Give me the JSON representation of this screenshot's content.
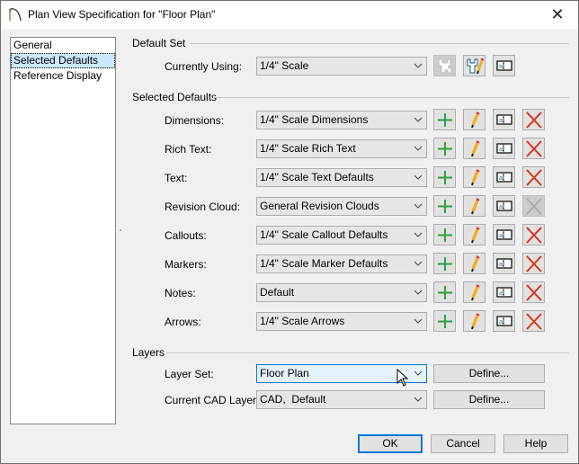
{
  "window": {
    "title": "Plan View Specification for \"Floor Plan\"",
    "close_icon": "close-icon"
  },
  "sidebar": {
    "items": [
      {
        "label": "General",
        "selected": false
      },
      {
        "label": "Selected Defaults",
        "selected": true
      },
      {
        "label": "Reference Display",
        "selected": false
      }
    ]
  },
  "default_set": {
    "group_label": "Default Set",
    "currently_using_label": "Currently Using:",
    "currently_using_value": "1/4\" Scale",
    "icons": [
      "save-default-set-icon",
      "edit-default-set-icon",
      "text-style-icon"
    ]
  },
  "selected_defaults": {
    "group_label": "Selected Defaults",
    "rows": [
      {
        "label": "Dimensions:",
        "value": "1/4\" Scale Dimensions",
        "delete_enabled": true
      },
      {
        "label": "Rich Text:",
        "value": "1/4\" Scale Rich Text",
        "delete_enabled": true
      },
      {
        "label": "Text:",
        "value": "1/4\" Scale Text Defaults",
        "delete_enabled": true
      },
      {
        "label": "Revision Cloud:",
        "value": "General Revision Clouds",
        "delete_enabled": false
      },
      {
        "label": "Callouts:",
        "value": "1/4\" Scale Callout Defaults",
        "delete_enabled": true
      },
      {
        "label": "Markers:",
        "value": "1/4\" Scale Marker Defaults",
        "delete_enabled": true
      },
      {
        "label": "Notes:",
        "value": "Default",
        "delete_enabled": true
      },
      {
        "label": "Arrows:",
        "value": "1/4\" Scale Arrows",
        "delete_enabled": true
      }
    ]
  },
  "layers": {
    "group_label": "Layers",
    "layer_set_label": "Layer Set:",
    "layer_set_value": "Floor Plan",
    "cad_layer_label": "Current CAD Layer:",
    "cad_layer_value": "CAD,  Default",
    "define_label": "Define..."
  },
  "footer": {
    "ok": "OK",
    "cancel": "Cancel",
    "help": "Help"
  },
  "colors": {
    "plus": "#2ea043",
    "delete": "#d9331f",
    "focus": "#0078d7",
    "selection": "#cce8ff"
  }
}
